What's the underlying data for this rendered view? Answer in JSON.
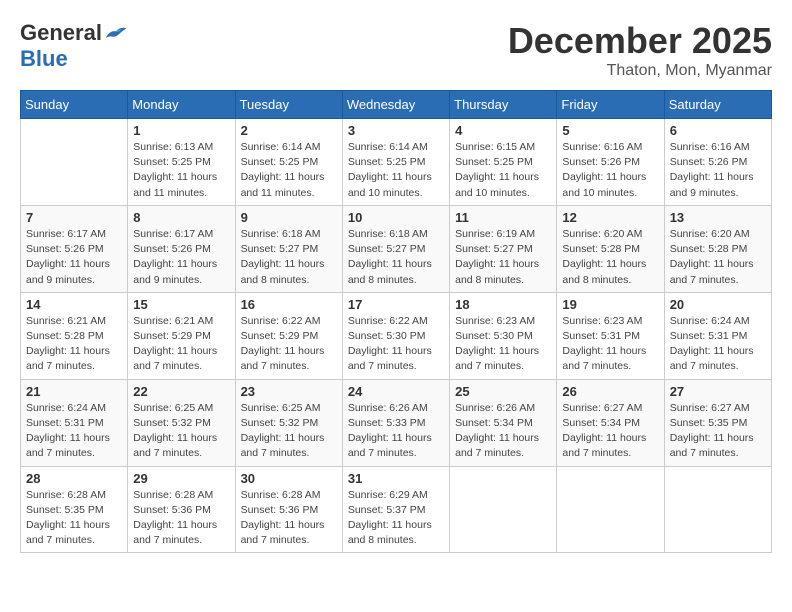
{
  "logo": {
    "general": "General",
    "blue": "Blue"
  },
  "title": {
    "month": "December 2025",
    "location": "Thaton, Mon, Myanmar"
  },
  "weekdays": [
    "Sunday",
    "Monday",
    "Tuesday",
    "Wednesday",
    "Thursday",
    "Friday",
    "Saturday"
  ],
  "weeks": [
    [
      {
        "day": "",
        "info": ""
      },
      {
        "day": "1",
        "info": "Sunrise: 6:13 AM\nSunset: 5:25 PM\nDaylight: 11 hours\nand 11 minutes."
      },
      {
        "day": "2",
        "info": "Sunrise: 6:14 AM\nSunset: 5:25 PM\nDaylight: 11 hours\nand 11 minutes."
      },
      {
        "day": "3",
        "info": "Sunrise: 6:14 AM\nSunset: 5:25 PM\nDaylight: 11 hours\nand 10 minutes."
      },
      {
        "day": "4",
        "info": "Sunrise: 6:15 AM\nSunset: 5:25 PM\nDaylight: 11 hours\nand 10 minutes."
      },
      {
        "day": "5",
        "info": "Sunrise: 6:16 AM\nSunset: 5:26 PM\nDaylight: 11 hours\nand 10 minutes."
      },
      {
        "day": "6",
        "info": "Sunrise: 6:16 AM\nSunset: 5:26 PM\nDaylight: 11 hours\nand 9 minutes."
      }
    ],
    [
      {
        "day": "7",
        "info": "Sunrise: 6:17 AM\nSunset: 5:26 PM\nDaylight: 11 hours\nand 9 minutes."
      },
      {
        "day": "8",
        "info": "Sunrise: 6:17 AM\nSunset: 5:26 PM\nDaylight: 11 hours\nand 9 minutes."
      },
      {
        "day": "9",
        "info": "Sunrise: 6:18 AM\nSunset: 5:27 PM\nDaylight: 11 hours\nand 8 minutes."
      },
      {
        "day": "10",
        "info": "Sunrise: 6:18 AM\nSunset: 5:27 PM\nDaylight: 11 hours\nand 8 minutes."
      },
      {
        "day": "11",
        "info": "Sunrise: 6:19 AM\nSunset: 5:27 PM\nDaylight: 11 hours\nand 8 minutes."
      },
      {
        "day": "12",
        "info": "Sunrise: 6:20 AM\nSunset: 5:28 PM\nDaylight: 11 hours\nand 8 minutes."
      },
      {
        "day": "13",
        "info": "Sunrise: 6:20 AM\nSunset: 5:28 PM\nDaylight: 11 hours\nand 7 minutes."
      }
    ],
    [
      {
        "day": "14",
        "info": "Sunrise: 6:21 AM\nSunset: 5:28 PM\nDaylight: 11 hours\nand 7 minutes."
      },
      {
        "day": "15",
        "info": "Sunrise: 6:21 AM\nSunset: 5:29 PM\nDaylight: 11 hours\nand 7 minutes."
      },
      {
        "day": "16",
        "info": "Sunrise: 6:22 AM\nSunset: 5:29 PM\nDaylight: 11 hours\nand 7 minutes."
      },
      {
        "day": "17",
        "info": "Sunrise: 6:22 AM\nSunset: 5:30 PM\nDaylight: 11 hours\nand 7 minutes."
      },
      {
        "day": "18",
        "info": "Sunrise: 6:23 AM\nSunset: 5:30 PM\nDaylight: 11 hours\nand 7 minutes."
      },
      {
        "day": "19",
        "info": "Sunrise: 6:23 AM\nSunset: 5:31 PM\nDaylight: 11 hours\nand 7 minutes."
      },
      {
        "day": "20",
        "info": "Sunrise: 6:24 AM\nSunset: 5:31 PM\nDaylight: 11 hours\nand 7 minutes."
      }
    ],
    [
      {
        "day": "21",
        "info": "Sunrise: 6:24 AM\nSunset: 5:31 PM\nDaylight: 11 hours\nand 7 minutes."
      },
      {
        "day": "22",
        "info": "Sunrise: 6:25 AM\nSunset: 5:32 PM\nDaylight: 11 hours\nand 7 minutes."
      },
      {
        "day": "23",
        "info": "Sunrise: 6:25 AM\nSunset: 5:32 PM\nDaylight: 11 hours\nand 7 minutes."
      },
      {
        "day": "24",
        "info": "Sunrise: 6:26 AM\nSunset: 5:33 PM\nDaylight: 11 hours\nand 7 minutes."
      },
      {
        "day": "25",
        "info": "Sunrise: 6:26 AM\nSunset: 5:34 PM\nDaylight: 11 hours\nand 7 minutes."
      },
      {
        "day": "26",
        "info": "Sunrise: 6:27 AM\nSunset: 5:34 PM\nDaylight: 11 hours\nand 7 minutes."
      },
      {
        "day": "27",
        "info": "Sunrise: 6:27 AM\nSunset: 5:35 PM\nDaylight: 11 hours\nand 7 minutes."
      }
    ],
    [
      {
        "day": "28",
        "info": "Sunrise: 6:28 AM\nSunset: 5:35 PM\nDaylight: 11 hours\nand 7 minutes."
      },
      {
        "day": "29",
        "info": "Sunrise: 6:28 AM\nSunset: 5:36 PM\nDaylight: 11 hours\nand 7 minutes."
      },
      {
        "day": "30",
        "info": "Sunrise: 6:28 AM\nSunset: 5:36 PM\nDaylight: 11 hours\nand 7 minutes."
      },
      {
        "day": "31",
        "info": "Sunrise: 6:29 AM\nSunset: 5:37 PM\nDaylight: 11 hours\nand 8 minutes."
      },
      {
        "day": "",
        "info": ""
      },
      {
        "day": "",
        "info": ""
      },
      {
        "day": "",
        "info": ""
      }
    ]
  ]
}
